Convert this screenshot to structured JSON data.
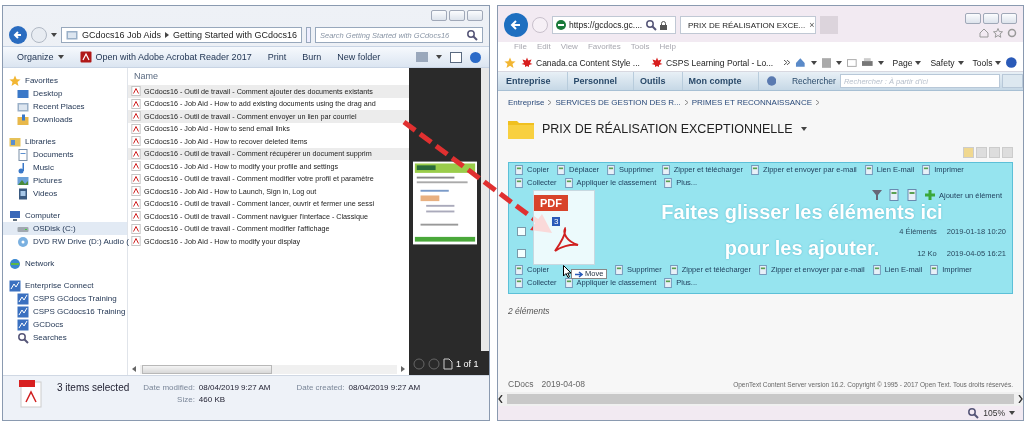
{
  "explorer": {
    "address": {
      "segments": [
        "GCdocs16 Job Aids",
        "Getting Started with GCdocs16"
      ],
      "search_placeholder": "Search Getting Started with GCdocs16"
    },
    "toolbar": [
      {
        "label": "Organize",
        "kind": "menu"
      },
      {
        "label": "Open with Adobe Acrobat Reader 2017",
        "kind": "pdf"
      },
      {
        "label": "Print",
        "kind": "plain"
      },
      {
        "label": "Burn",
        "kind": "plain"
      },
      {
        "label": "New folder",
        "kind": "plain"
      }
    ],
    "nav": [
      {
        "label": "Favorites",
        "kind": "star",
        "selected": false,
        "children": [
          {
            "label": "Desktop",
            "kind": "desktop",
            "selected": false
          },
          {
            "label": "Recent Places",
            "kind": "folder",
            "selected": false
          },
          {
            "label": "Downloads",
            "kind": "download",
            "selected": false
          }
        ]
      },
      {
        "label": "Libraries",
        "kind": "library",
        "selected": false,
        "children": [
          {
            "label": "Documents",
            "kind": "document",
            "selected": false
          },
          {
            "label": "Music",
            "kind": "music",
            "selected": false
          },
          {
            "label": "Pictures",
            "kind": "picture",
            "selected": false
          },
          {
            "label": "Videos",
            "kind": "video",
            "selected": false
          }
        ]
      },
      {
        "label": "Computer",
        "kind": "computer",
        "selected": false,
        "children": [
          {
            "label": "OSDisk (C:)",
            "kind": "drive",
            "selected": true
          },
          {
            "label": "DVD RW Drive (D:) Audio (",
            "kind": "disc",
            "selected": false
          }
        ]
      },
      {
        "label": "Network",
        "kind": "network",
        "selected": false
      },
      {
        "label": "Enterprise Connect",
        "kind": "server",
        "selected": false,
        "children": [
          {
            "label": "CSPS GCdocs Training",
            "kind": "server",
            "selected": false
          },
          {
            "label": "CSPS GCdocs16 Training",
            "kind": "server",
            "selected": false
          },
          {
            "label": "GCDocs",
            "kind": "server",
            "selected": false
          },
          {
            "label": "Searches",
            "kind": "search",
            "selected": false
          }
        ]
      }
    ],
    "column_header": "Name",
    "files": [
      {
        "name": "GCdocs16 - Outil de travail - Comment ajouter des documents existants",
        "selected": true
      },
      {
        "name": "GCdocs16 - Job Aid - How to add existing documents using the drag and",
        "selected": false
      },
      {
        "name": "GCdocs16 - Outil de travail - Comment envoyer un lien par courriel",
        "selected": true
      },
      {
        "name": "GCdocs16 - Job Aid - How to send email links",
        "selected": false
      },
      {
        "name": "GCdocs16 - Job Aid - How to recover deleted items",
        "selected": false
      },
      {
        "name": "GCdocs16 - Outil de travail - Comment récupérer un document supprim",
        "selected": true
      },
      {
        "name": "GCdocs16 - Job Aid - How to modify your profile and settings",
        "selected": false
      },
      {
        "name": "GCdocs16 - Outil de travail - Comment modifier votre profil et paramètre",
        "selected": false
      },
      {
        "name": "GCdocs16 - Job Aid - How to Launch, Sign in, Log out",
        "selected": false
      },
      {
        "name": "GCdocs16 - Outil de travail - Comment lancer, ouvrir et fermer une sessi",
        "selected": false
      },
      {
        "name": "GCdocs16 - Outil de travail - Comment naviguer l'interface - Classique",
        "selected": false
      },
      {
        "name": "GCdocs16 - Outil de travail - Comment modifier l'affichage",
        "selected": false
      },
      {
        "name": "GCdocs16 - Job Aid - How to modify your display",
        "selected": false
      }
    ],
    "preview": {
      "page_label": "1 of 1"
    },
    "status": {
      "summary": "3 items selected",
      "fields": [
        {
          "label": "Date modified:",
          "value": "08/04/2019 9:27 AM"
        },
        {
          "label": "Date created:",
          "value": "08/04/2019 9:27 AM"
        },
        {
          "label": "Size:",
          "value": "460 KB"
        }
      ]
    }
  },
  "browser": {
    "address": "https://gcdocs.gc....",
    "tab": {
      "title": "PRIX DE RÉALISATION EXCE...",
      "close": "×"
    },
    "menu": [
      "File",
      "Edit",
      "View",
      "Favorites",
      "Tools",
      "Help"
    ],
    "favorites": [
      "Canada.ca Content Style ...",
      "CSPS Learning Portal - Lo..."
    ],
    "commands": [
      "Page",
      "Safety",
      "Tools"
    ],
    "app_nav": [
      "Entreprise",
      "Personnel",
      "Outils",
      "Mon compte"
    ],
    "search": {
      "label": "Rechercher",
      "placeholder": "Rechercher : À partir d'ici"
    },
    "breadcrumb": [
      "Entreprise",
      "SERVICES DE GESTION DES R...",
      "PRIMES ET RECONNAISSANCE"
    ],
    "title": "PRIX DE RÉALISATION EXCEPTIONNELLE",
    "actions_top": [
      "Copier",
      "Déplacer",
      "Supprimer",
      "Zipper et télécharger",
      "Zipper et envoyer par e-mail",
      "Lien E-mail",
      "Imprimer",
      "Collecter",
      "Appliquer le classement",
      "Plus..."
    ],
    "actions_bottom": [
      "Copier",
      "Supprimer",
      "Zipper et télécharger",
      "Zipper et envoyer par e-mail",
      "Lien E-mail",
      "Imprimer",
      "Collecter",
      "Appliquer le classement",
      "Plus..."
    ],
    "add_item": "Ajouter un élément",
    "rows": [
      {
        "checked": false,
        "size": "4 Éléments",
        "modified": "2019-01-18 10:20"
      },
      {
        "checked": false,
        "size": "12 Ko",
        "modified": "2019-04-05 16:21"
      }
    ],
    "drop_message": [
      "Faites glisser les éléments ici",
      "pour les ajouter."
    ],
    "drag": {
      "type_label": "PDF",
      "count": "3",
      "tooltip": "Move"
    },
    "count": "2 éléments",
    "footer_left": [
      "CDocs",
      "2019-04-08"
    ],
    "footer_right": "OpenText Content Server version 16.2. Copyright © 1995 - 2017 Open Text. Tous droits réservés.",
    "zoom": "105%"
  }
}
